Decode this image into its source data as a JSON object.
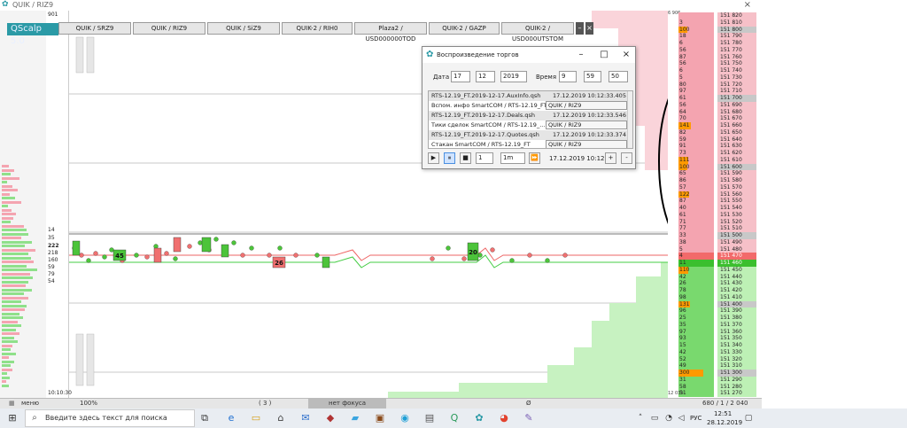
{
  "window": {
    "title": "QUIK / RIZ9",
    "close": "×"
  },
  "brand": {
    "label": "QScalp 5.0"
  },
  "tabs": [
    "QUIK / SRZ9",
    "QUIK / RIZ9",
    "QUIK / SiZ9",
    "QUIK-2 / RIH0",
    "Plaza2 / USD000000TOD",
    "QUIK-2 / GAZP",
    "QUIK-2 / USD000UTSTOM"
  ],
  "tab_controls": {
    "minimize": "–",
    "close": "×"
  },
  "left_numbers": {
    "top": "901",
    "bottom": "10:10:30"
  },
  "cluster": [
    "14",
    "35",
    "222",
    "218",
    "160",
    "59",
    "79",
    "54"
  ],
  "chart_tags": [
    "45",
    "26",
    "20"
  ],
  "ladder_volumes": {
    "top_sell": "6 906",
    "bottom_buy": "12 039"
  },
  "ladder": [
    {
      "v": "",
      "p": "151 820",
      "t": "s"
    },
    {
      "v": "3",
      "p": "151 810",
      "t": "s"
    },
    {
      "v": "100",
      "p": "151 800",
      "t": "s",
      "hi": true
    },
    {
      "v": "18",
      "p": "151 790",
      "t": "s"
    },
    {
      "v": "6",
      "p": "151 780",
      "t": "s"
    },
    {
      "v": "56",
      "p": "151 770",
      "t": "s"
    },
    {
      "v": "87",
      "p": "151 760",
      "t": "s"
    },
    {
      "v": "56",
      "p": "151 750",
      "t": "s"
    },
    {
      "v": "6",
      "p": "151 740",
      "t": "s"
    },
    {
      "v": "5",
      "p": "151 730",
      "t": "s"
    },
    {
      "v": "80",
      "p": "151 720",
      "t": "s"
    },
    {
      "v": "97",
      "p": "151 710",
      "t": "s"
    },
    {
      "v": "61",
      "p": "151 700",
      "t": "s",
      "hi": true
    },
    {
      "v": "56",
      "p": "151 690",
      "t": "s"
    },
    {
      "v": "64",
      "p": "151 680",
      "t": "s"
    },
    {
      "v": "70",
      "p": "151 670",
      "t": "s"
    },
    {
      "v": "141",
      "p": "151 660",
      "t": "s"
    },
    {
      "v": "82",
      "p": "151 650",
      "t": "s"
    },
    {
      "v": "59",
      "p": "151 640",
      "t": "s"
    },
    {
      "v": "91",
      "p": "151 630",
      "t": "s"
    },
    {
      "v": "73",
      "p": "151 620",
      "t": "s"
    },
    {
      "v": "111",
      "p": "151 610",
      "t": "s"
    },
    {
      "v": "100",
      "p": "151 600",
      "t": "s",
      "hi": true
    },
    {
      "v": "65",
      "p": "151 590",
      "t": "s"
    },
    {
      "v": "86",
      "p": "151 580",
      "t": "s"
    },
    {
      "v": "57",
      "p": "151 570",
      "t": "s"
    },
    {
      "v": "122",
      "p": "151 560",
      "t": "s"
    },
    {
      "v": "87",
      "p": "151 550",
      "t": "s"
    },
    {
      "v": "40",
      "p": "151 540",
      "t": "s"
    },
    {
      "v": "61",
      "p": "151 530",
      "t": "s"
    },
    {
      "v": "71",
      "p": "151 520",
      "t": "s"
    },
    {
      "v": "77",
      "p": "151 510",
      "t": "s"
    },
    {
      "v": "33",
      "p": "151 500",
      "t": "s",
      "hi": true
    },
    {
      "v": "38",
      "p": "151 490",
      "t": "s"
    },
    {
      "v": "5",
      "p": "151 480",
      "t": "s"
    },
    {
      "v": "4",
      "p": "151 470",
      "t": "ask"
    },
    {
      "v": "11",
      "p": "151 460",
      "t": "bid"
    },
    {
      "v": "110",
      "p": "151 450",
      "t": "b"
    },
    {
      "v": "42",
      "p": "151 440",
      "t": "b"
    },
    {
      "v": "26",
      "p": "151 430",
      "t": "b"
    },
    {
      "v": "78",
      "p": "151 420",
      "t": "b"
    },
    {
      "v": "98",
      "p": "151 410",
      "t": "b"
    },
    {
      "v": "131",
      "p": "151 400",
      "t": "b",
      "hi": true
    },
    {
      "v": "96",
      "p": "151 390",
      "t": "b"
    },
    {
      "v": "25",
      "p": "151 380",
      "t": "b"
    },
    {
      "v": "35",
      "p": "151 370",
      "t": "b"
    },
    {
      "v": "97",
      "p": "151 360",
      "t": "b"
    },
    {
      "v": "93",
      "p": "151 350",
      "t": "b"
    },
    {
      "v": "15",
      "p": "151 340",
      "t": "b"
    },
    {
      "v": "42",
      "p": "151 330",
      "t": "b"
    },
    {
      "v": "52",
      "p": "151 320",
      "t": "b"
    },
    {
      "v": "49",
      "p": "151 310",
      "t": "b"
    },
    {
      "v": "300",
      "p": "151 300",
      "t": "b",
      "hi": true
    },
    {
      "v": "31",
      "p": "151 290",
      "t": "b"
    },
    {
      "v": "58",
      "p": "151 280",
      "t": "b"
    },
    {
      "v": "51",
      "p": "151 270",
      "t": "b"
    }
  ],
  "dialog": {
    "title": "Воспроизведение торгов",
    "date_label": "Дата",
    "day": "17",
    "month": "12",
    "year": "2019",
    "time_label": "Время",
    "hour": "9",
    "minute": "59",
    "second": "50",
    "files": [
      {
        "name": "RTS-12.19_FT.2019-12-17.AuxInfo.qsh",
        "time": "17.12.2019 10:12:33.405"
      },
      {
        "name": "Вспом. инфо SmartCOM / RTS-12.19_FT",
        "select": "QUIK / RIZ9"
      },
      {
        "name": "RTS-12.19_FT.2019-12-17.Deals.qsh",
        "time": "17.12.2019 10:12:33.546"
      },
      {
        "name": "Тики сделок SmartCOM / RTS-12.19_...",
        "select": "QUIK / RIZ9"
      },
      {
        "name": "RTS-12.19_FT.2019-12-17.Quotes.qsh",
        "time": "17.12.2019 10:12:33.374"
      },
      {
        "name": "Стакан SmartCOM / RTS-12.19_FT",
        "select": "QUIK / RIZ9"
      }
    ],
    "play": "▶",
    "pause": "⏸",
    "stop": "■",
    "speed": "1",
    "interval": "1m",
    "forward": "⏩",
    "current_time": "17.12.2019 10:12:33",
    "plus": "+",
    "minus": "-"
  },
  "statusbar": {
    "menu": "меню",
    "zoom": "100%",
    "count": "( 3 )",
    "focus": "нет фокуса",
    "empty": "Ø",
    "coords": "680  /  1  /  2 040"
  },
  "taskbar": {
    "search_placeholder": "Введите здесь текст для поиска",
    "lang": "РУС",
    "time": "12:51",
    "date": "28.12.2019"
  },
  "colors": {
    "accent": "#2b9aa6",
    "sell": "#f4a4b0",
    "buy": "#79d96e",
    "ask": "#f26a6a",
    "bid": "#3bbf2e",
    "hilite": "#ff9a00"
  }
}
